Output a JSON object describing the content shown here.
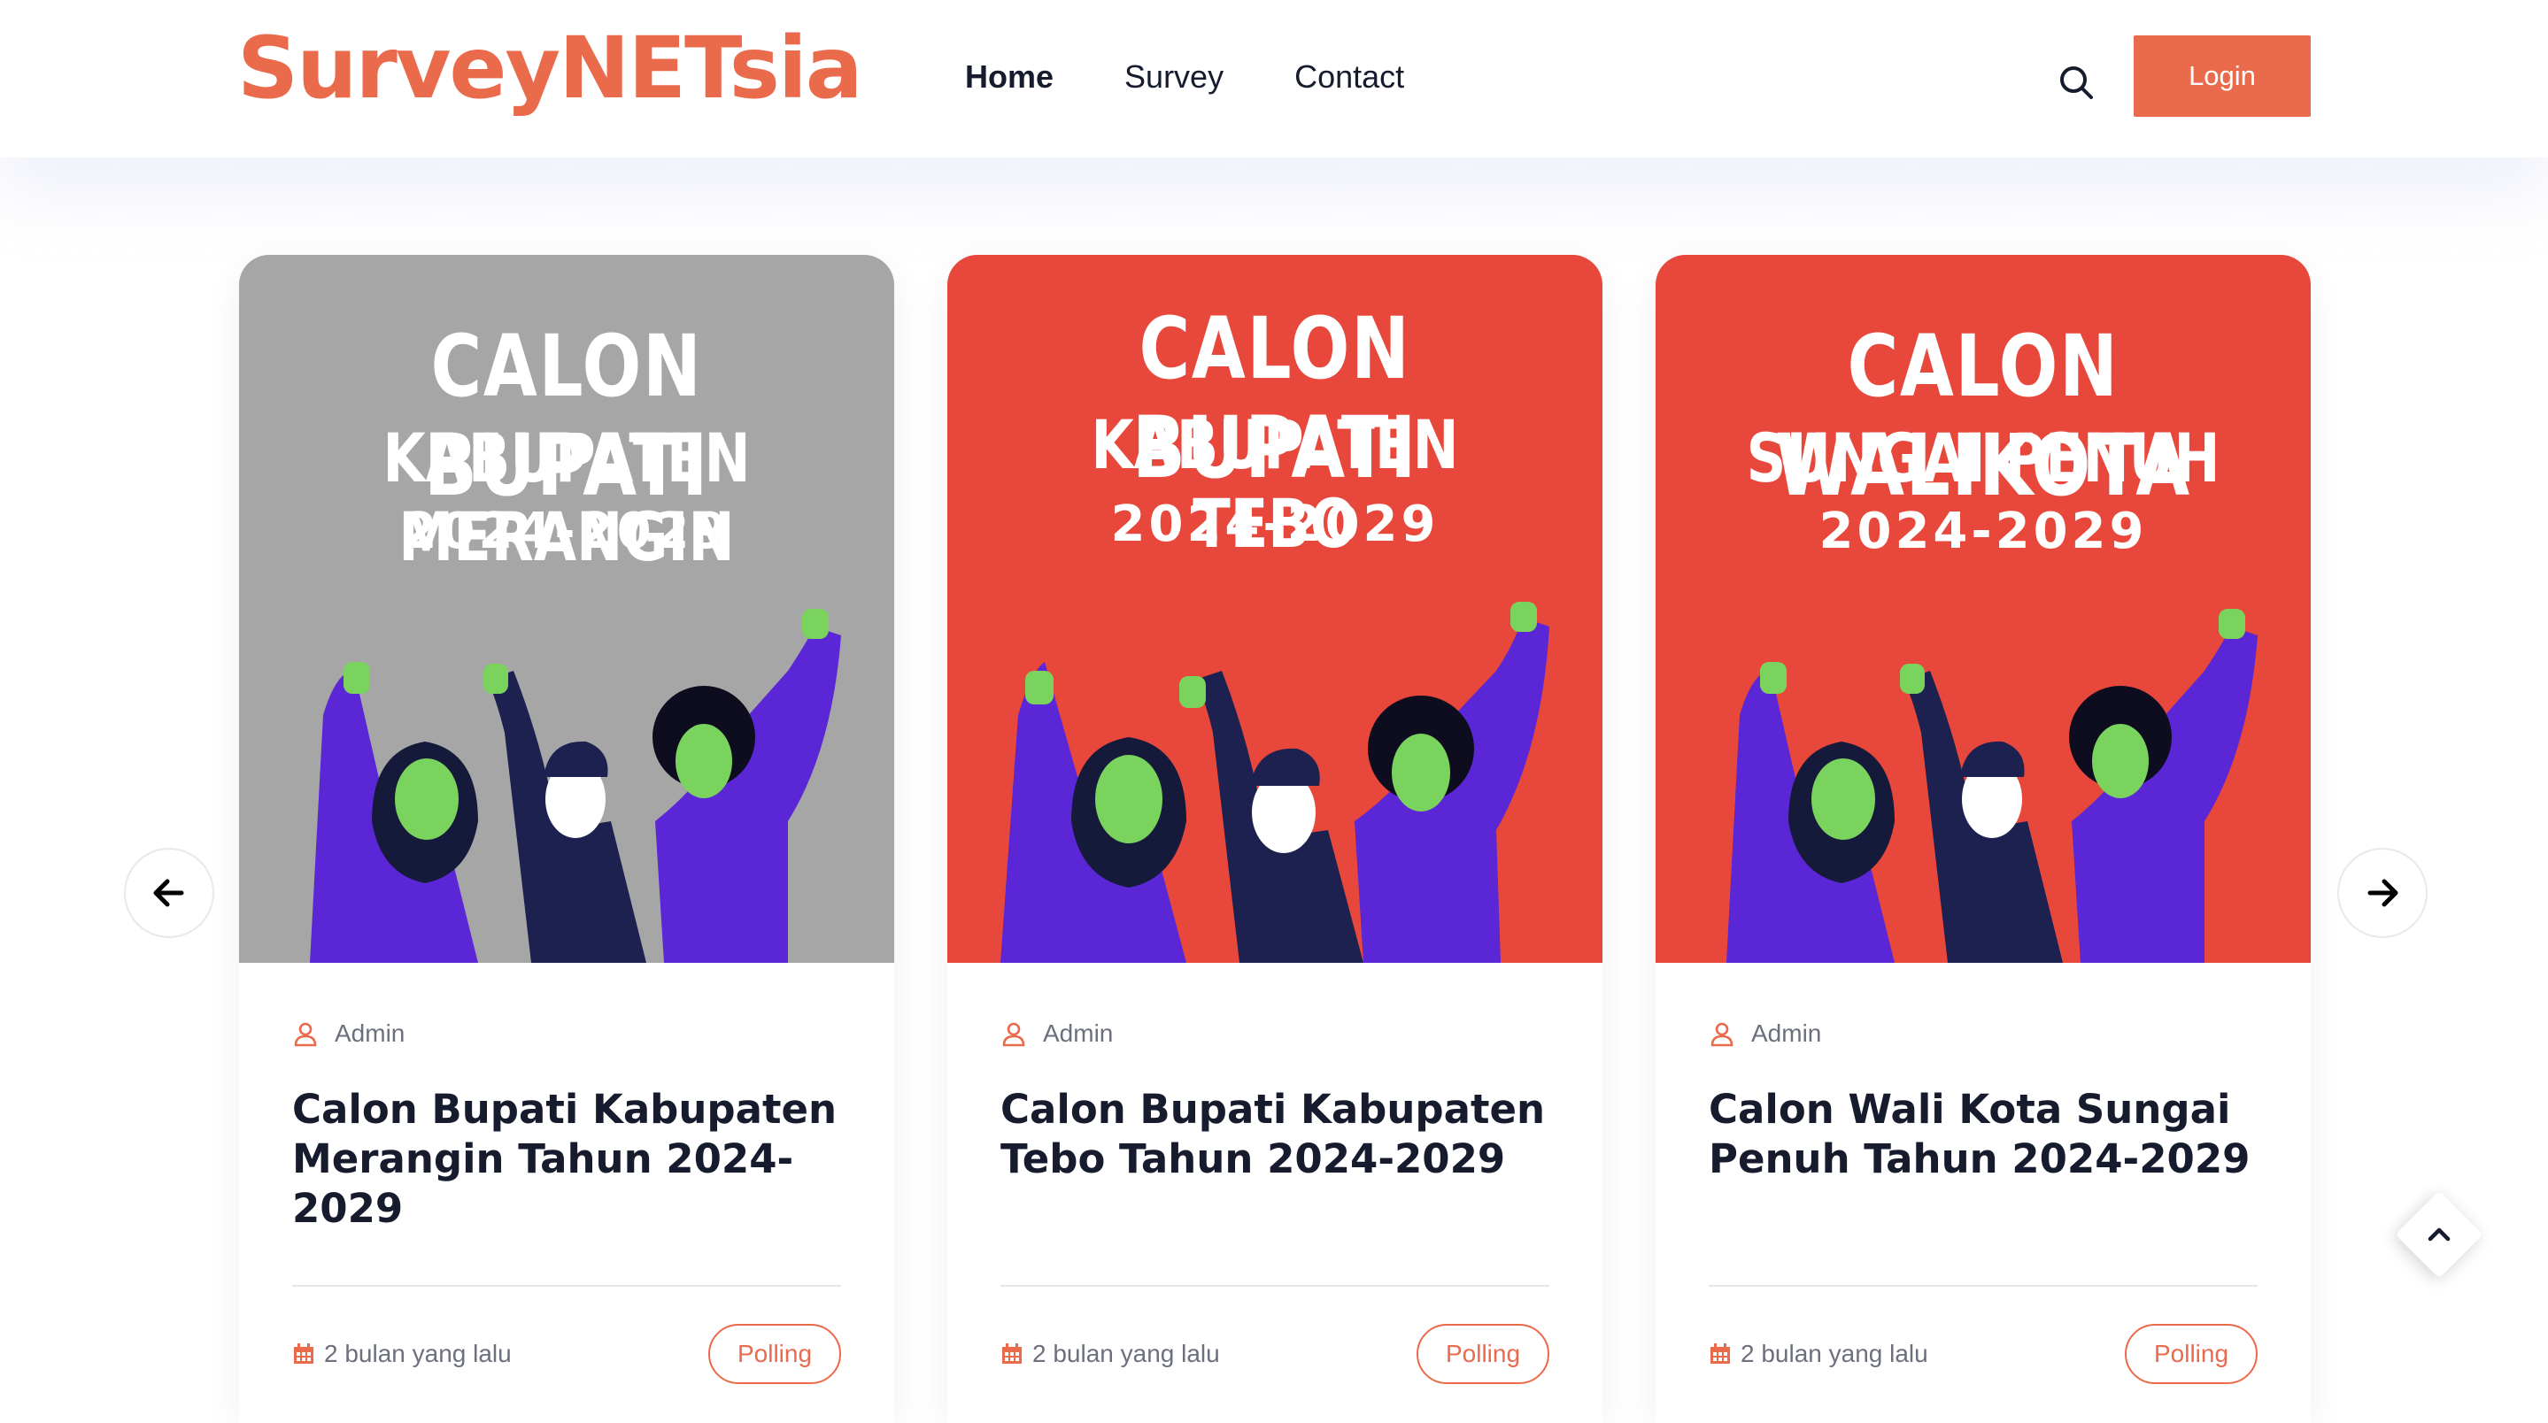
{
  "brand": {
    "name": "SurveyNETsia",
    "accent": "#ea6a4c"
  },
  "nav": {
    "items": [
      "Home",
      "Survey",
      "Contact"
    ],
    "active": "Home"
  },
  "header": {
    "login_label": "Login",
    "search_icon": "search-icon"
  },
  "carousel": {
    "prev_icon": "arrow-left-icon",
    "next_icon": "arrow-right-icon"
  },
  "cards": [
    {
      "poster": {
        "line1": "CALON BUPATI",
        "line2": "KABUPATEN MERANGIN",
        "line3": "2024-2029",
        "bg": "#a6a6a6"
      },
      "author": "Admin",
      "title": "Calon Bupati Kabupaten Merangin Tahun 2024-2029",
      "date": "2 bulan yang lalu",
      "category": "Polling"
    },
    {
      "poster": {
        "line1": "CALON BUPATI",
        "line2": "KABUPATEN TEBO",
        "line3": "2024-2029",
        "bg": "#e8473c"
      },
      "author": "Admin",
      "title": "Calon Bupati Kabupaten Tebo Tahun 2024-2029",
      "date": "2 bulan yang lalu",
      "category": "Polling"
    },
    {
      "poster": {
        "line1": "CALON WALIKOTA",
        "line2": "SUNGAI PENUH",
        "line3": "2024-2029",
        "bg": "#e8473c"
      },
      "author": "Admin",
      "title": "Calon Wali Kota Sungai Penuh Tahun 2024-2029",
      "date": "2 bulan yang lalu",
      "category": "Polling"
    }
  ],
  "back_to_top_icon": "chevron-up-icon"
}
